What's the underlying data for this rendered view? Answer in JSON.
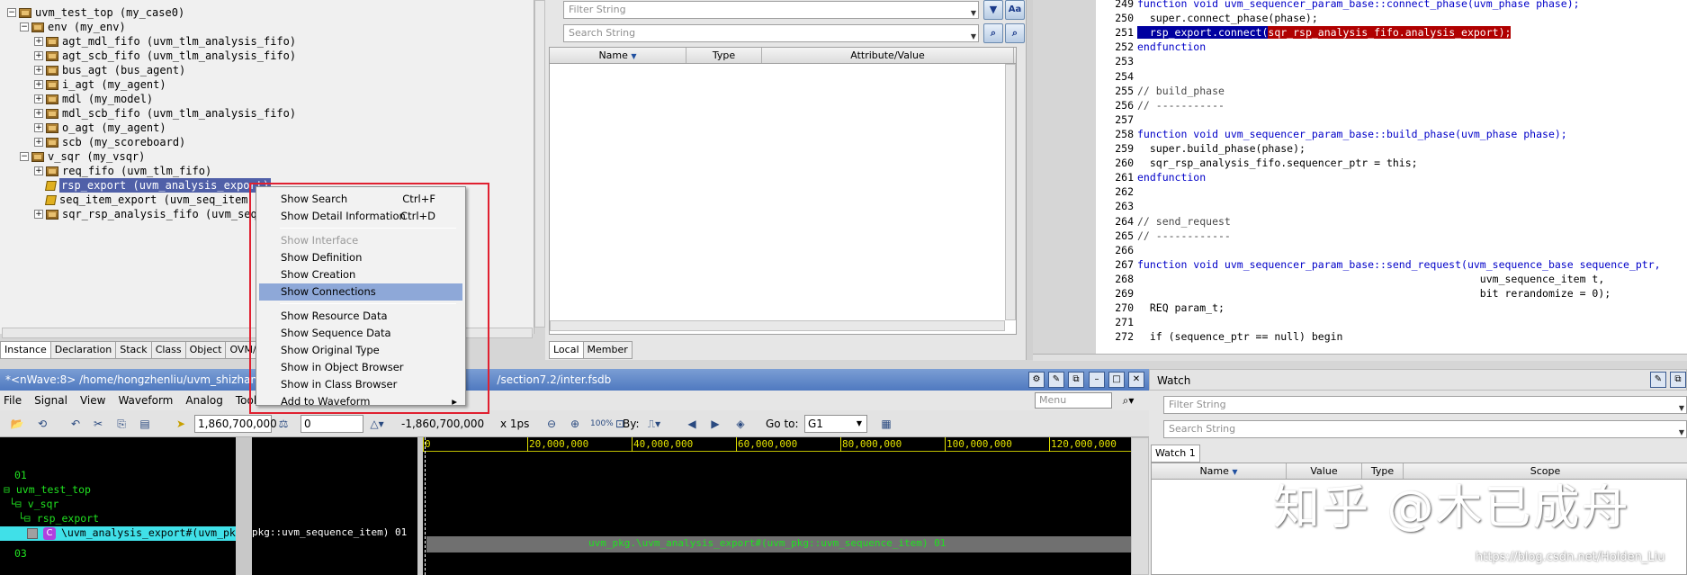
{
  "hierarchy": {
    "rows": [
      {
        "pm": "⊟",
        "icon": "inst",
        "text": "uvm_test_top (my_case0)"
      },
      {
        "pm": "⊟",
        "icon": "inst",
        "text": "env (my_env)"
      },
      {
        "pm": "⊞",
        "icon": "inst",
        "text": "agt_mdl_fifo (uvm_tlm_analysis_fifo)"
      },
      {
        "pm": "⊞",
        "icon": "inst",
        "text": "agt_scb_fifo (uvm_tlm_analysis_fifo)"
      },
      {
        "pm": "⊞",
        "icon": "inst",
        "text": "bus_agt (bus_agent)"
      },
      {
        "pm": "⊞",
        "icon": "inst",
        "text": "i_agt (my_agent)"
      },
      {
        "pm": "⊞",
        "icon": "inst",
        "text": "mdl (my_model)"
      },
      {
        "pm": "⊞",
        "icon": "inst",
        "text": "mdl_scb_fifo (uvm_tlm_analysis_fifo)"
      },
      {
        "pm": "⊞",
        "icon": "inst",
        "text": "o_agt (my_agent)"
      },
      {
        "pm": "⊞",
        "icon": "inst",
        "text": "scb (my_scoreboard)"
      },
      {
        "pm": "⊟",
        "icon": "inst",
        "text": "v_sqr (my_vsqr)"
      },
      {
        "pm": "⊞",
        "icon": "inst",
        "text": "req_fifo (uvm_tlm_fifo)"
      },
      {
        "pm": "",
        "icon": "port",
        "text": "rsp_export (uvm_analysis_export)"
      },
      {
        "pm": "",
        "icon": "port",
        "text": "seq_item_export (uvm_seq_item"
      },
      {
        "pm": "⊞",
        "icon": "inst",
        "text": "sqr_rsp_analysis_fifo (uvm_seq"
      }
    ],
    "tabs": [
      "Instance",
      "Declaration",
      "Stack",
      "Class",
      "Object",
      "OVM/U"
    ]
  },
  "member_panel": {
    "filter_placeholder": "Filter String",
    "search_placeholder": "Search String",
    "columns": [
      "Name",
      "Type",
      "Attribute/Value"
    ],
    "tabs": [
      "Local",
      "Member"
    ],
    "icons": [
      "filter-icon",
      "match-case-icon",
      "search-icon",
      "find-icon"
    ]
  },
  "code": {
    "lines": [
      {
        "n": "249",
        "t": "function void uvm_sequencer_param_base::connect_phase(uvm_phase phase);"
      },
      {
        "n": "250",
        "t": "  super.connect_phase(phase);"
      },
      {
        "n": "251",
        "t": "  rsp_export.connect(sqr_rsp_analysis_fifo.analysis_export);"
      },
      {
        "n": "252",
        "t": "endfunction"
      },
      {
        "n": "253",
        "t": ""
      },
      {
        "n": "254",
        "t": ""
      },
      {
        "n": "255",
        "t": "// build_phase"
      },
      {
        "n": "256",
        "t": "// -----------"
      },
      {
        "n": "257",
        "t": ""
      },
      {
        "n": "258",
        "t": "function void uvm_sequencer_param_base::build_phase(uvm_phase phase);"
      },
      {
        "n": "259",
        "t": "  super.build_phase(phase);"
      },
      {
        "n": "260",
        "t": "  sqr_rsp_analysis_fifo.sequencer_ptr = this;"
      },
      {
        "n": "261",
        "t": "endfunction"
      },
      {
        "n": "262",
        "t": ""
      },
      {
        "n": "263",
        "t": ""
      },
      {
        "n": "264",
        "t": "// send_request"
      },
      {
        "n": "265",
        "t": "// ------------"
      },
      {
        "n": "266",
        "t": ""
      },
      {
        "n": "267",
        "t": "function void uvm_sequencer_param_base::send_request(uvm_sequence_base sequence_ptr,"
      },
      {
        "n": "268",
        "t": "                                                       uvm_sequence_item t,"
      },
      {
        "n": "269",
        "t": "                                                       bit rerandomize = 0);"
      },
      {
        "n": "270",
        "t": "  REQ param_t;"
      },
      {
        "n": "271",
        "t": ""
      },
      {
        "n": "272",
        "t": "  if (sequence_ptr == null) begin"
      }
    ]
  },
  "context_menu": {
    "items": [
      {
        "label": "Show Search",
        "shortcut": "Ctrl+F",
        "disabled": false
      },
      {
        "label": "Show Detail Information",
        "shortcut": "Ctrl+D",
        "disabled": false
      },
      {
        "sep": true
      },
      {
        "label": "Show Interface",
        "shortcut": "",
        "disabled": true
      },
      {
        "label": "Show Definition",
        "shortcut": "",
        "disabled": false
      },
      {
        "label": "Show Creation",
        "shortcut": "",
        "disabled": false
      },
      {
        "label": "Show Connections",
        "shortcut": "",
        "disabled": false,
        "hot": true
      },
      {
        "sep": true
      },
      {
        "label": "Show Resource Data",
        "shortcut": "",
        "disabled": false
      },
      {
        "label": "Show Sequence Data",
        "shortcut": "",
        "disabled": false
      },
      {
        "label": "Show Original Type",
        "shortcut": "",
        "disabled": false
      },
      {
        "label": "Show in Object Browser",
        "shortcut": "",
        "disabled": false
      },
      {
        "label": "Show in Class Browser",
        "shortcut": "",
        "disabled": false
      },
      {
        "label": "Add to Waveform",
        "shortcut": "",
        "disabled": false,
        "submenu": true
      }
    ]
  },
  "nwave": {
    "title": "*<nWave:8> /home/hongzhenliu/uvm_shizhan/ex",
    "title_tail": "/section7.2/inter.fsdb",
    "menus": [
      "File",
      "Signal",
      "View",
      "Waveform",
      "Analog",
      "Tools"
    ],
    "cursor_time": "1,860,700,000",
    "marker_time": "0",
    "delta_time": "-1,860,700,000",
    "scale": "x 1ps",
    "by_label": "By:",
    "goto_label": "Go to:",
    "goto_value": "G1",
    "menu_search": "Menu",
    "signals": {
      "g1": "01",
      "top": "uvm_test_top",
      "vsqr": "v_sqr",
      "rsp": "rsp_export",
      "obj": "\\uvm_analysis_export#(uvm_pk",
      "g3": "03"
    },
    "value_text": "pkg::uvm_sequence_item) 01",
    "wave_text": "uvm_pkg.\\uvm_analysis_export#(uvm_pkg::uvm_sequence_item) 01",
    "ruler": [
      "0",
      "20,000,000",
      "40,000,000",
      "60,000,000",
      "80,000,000",
      "100,000,000",
      "120,000,000"
    ]
  },
  "watch": {
    "title": "Watch",
    "filter_placeholder": "Filter String",
    "search_placeholder": "Search String",
    "tab": "Watch 1",
    "columns": [
      "Name",
      "Value",
      "Type",
      "Scope"
    ]
  },
  "watermark": "知乎 @木已成舟",
  "csdn": "https://blog.csdn.net/Holden_Liu"
}
